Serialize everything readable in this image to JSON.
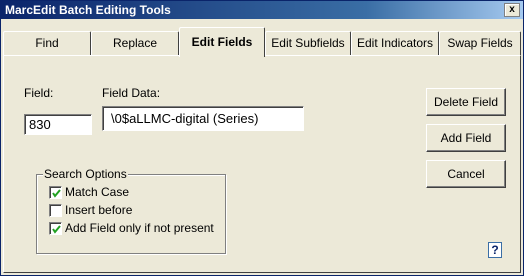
{
  "window": {
    "title": "MarcEdit Batch Editing Tools",
    "close_glyph": "x"
  },
  "tabs": [
    {
      "label": "Find"
    },
    {
      "label": "Replace"
    },
    {
      "label": "Edit Fields",
      "active": true
    },
    {
      "label": "Edit Subfields"
    },
    {
      "label": "Edit Indicators"
    },
    {
      "label": "Swap Fields"
    }
  ],
  "form": {
    "field_label": "Field:",
    "field_value": "830",
    "field_data_label": "Field Data:",
    "field_data_value": "\\0$aLLMC-digital (Series)"
  },
  "buttons": {
    "delete_field": "Delete Field",
    "add_field": "Add Field",
    "cancel": "Cancel"
  },
  "search_options": {
    "legend": "Search Options",
    "items": [
      {
        "label": "Match Case",
        "checked": true
      },
      {
        "label": "Insert before",
        "checked": false
      },
      {
        "label": "Add Field only if not present",
        "checked": true
      }
    ]
  },
  "help": {
    "icon": "help-icon",
    "glyph": "?"
  }
}
